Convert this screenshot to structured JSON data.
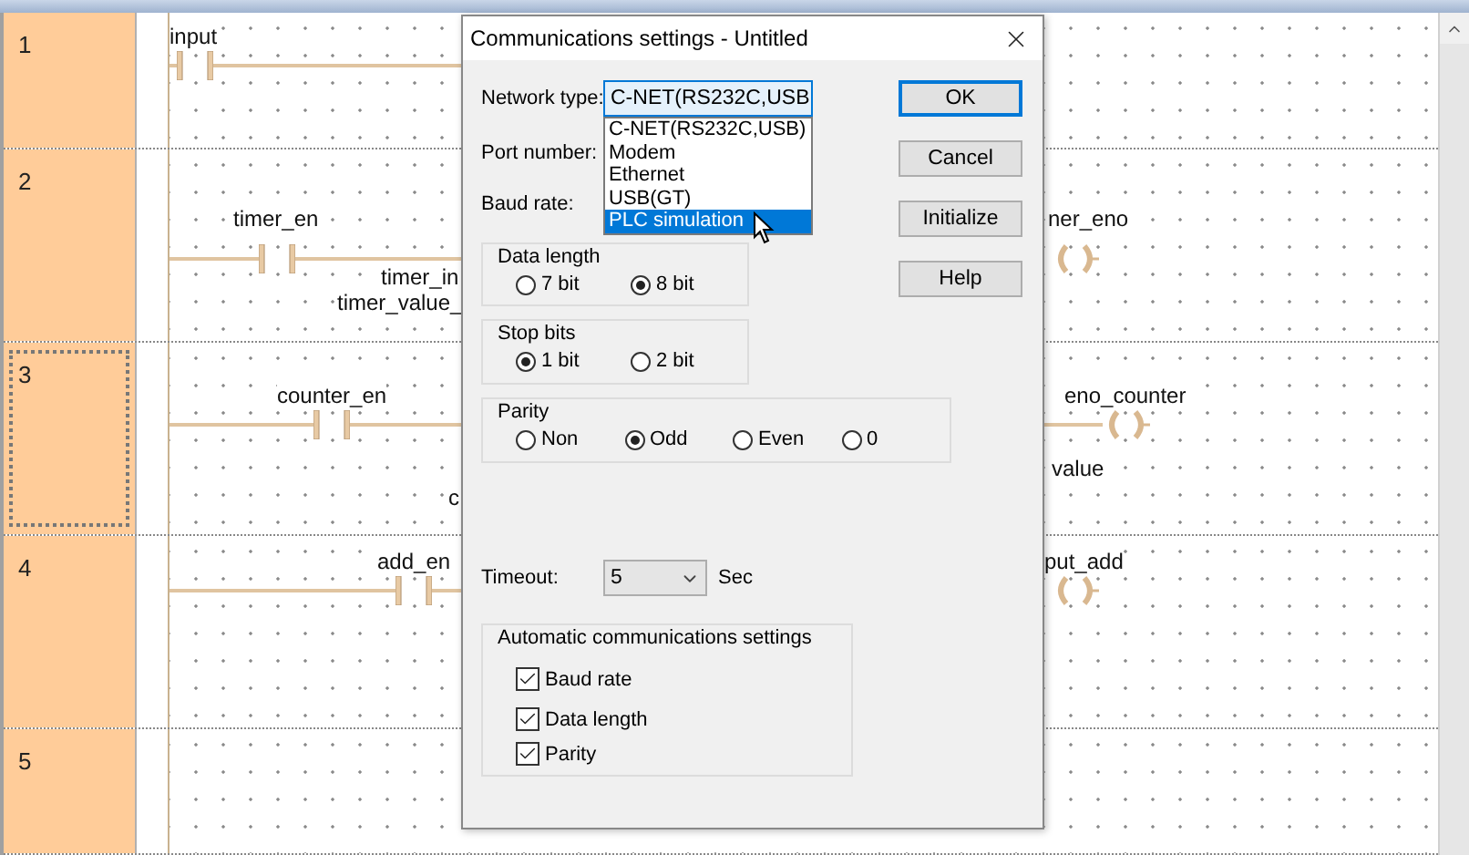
{
  "rungs": [
    {
      "number": "1",
      "selected": false,
      "labels": [
        "input"
      ]
    },
    {
      "number": "2",
      "selected": false,
      "labels": [
        "timer_en",
        "timer_in",
        "timer_value_",
        "ner_eno"
      ]
    },
    {
      "number": "3",
      "selected": true,
      "labels": [
        "counter_en",
        "c",
        "eno_counter",
        "value"
      ]
    },
    {
      "number": "4",
      "selected": false,
      "labels": [
        "add_en",
        "put_add"
      ]
    },
    {
      "number": "5",
      "selected": false
    }
  ],
  "dialog": {
    "title": "Communications settings - Untitled",
    "network_type": {
      "label": "Network type:",
      "value": "C-NET(RS232C,USB",
      "expanded": true,
      "options": [
        {
          "label": "C-NET(RS232C,USB)",
          "selected": false
        },
        {
          "label": "Modem",
          "selected": false
        },
        {
          "label": "Ethernet",
          "selected": false
        },
        {
          "label": "USB(GT)",
          "selected": false
        },
        {
          "label": "PLC simulation",
          "selected": true
        }
      ]
    },
    "port_number": {
      "label": "Port number:"
    },
    "baud_rate": {
      "label": "Baud rate:"
    },
    "data_length": {
      "legend": "Data length",
      "options": [
        {
          "label": "7 bit",
          "selected": false
        },
        {
          "label": "8 bit",
          "selected": true
        }
      ]
    },
    "stop_bits": {
      "legend": "Stop bits",
      "options": [
        {
          "label": "1 bit",
          "selected": true
        },
        {
          "label": "2 bit",
          "selected": false
        }
      ]
    },
    "parity": {
      "legend": "Parity",
      "options": [
        {
          "label": "Non",
          "selected": false
        },
        {
          "label": "Odd",
          "selected": true
        },
        {
          "label": "Even",
          "selected": false
        },
        {
          "label": "0",
          "selected": false
        }
      ]
    },
    "timeout": {
      "label": "Timeout:",
      "value": "5",
      "unit": "Sec"
    },
    "auto_settings": {
      "legend": "Automatic communications settings",
      "items": [
        {
          "label": "Baud rate",
          "checked": true
        },
        {
          "label": "Data length",
          "checked": true
        },
        {
          "label": "Parity",
          "checked": true
        }
      ]
    },
    "buttons": [
      {
        "label": "OK",
        "default": true
      },
      {
        "label": "Cancel",
        "default": false
      },
      {
        "label": "Initialize",
        "default": false
      },
      {
        "label": "Help",
        "default": false
      }
    ]
  }
}
